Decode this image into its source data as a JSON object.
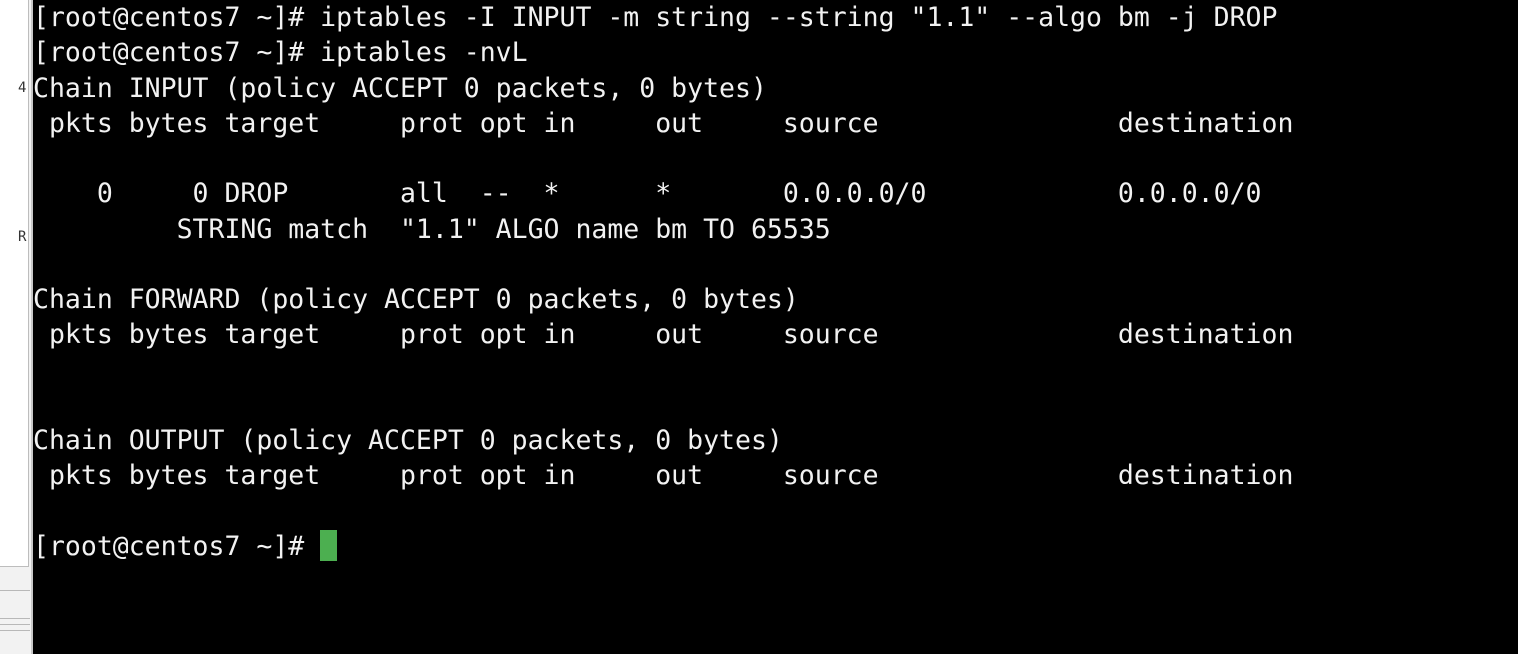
{
  "terminal": {
    "lines": [
      "[root@centos7 ~]# iptables -I INPUT -m string --string \"1.1\" --algo bm -j DROP",
      "[root@centos7 ~]# iptables -nvL",
      "Chain INPUT (policy ACCEPT 0 packets, 0 bytes)",
      " pkts bytes target     prot opt in     out     source               destination",
      "",
      "    0     0 DROP       all  --  *      *       0.0.0.0/0            0.0.0.0/0",
      "         STRING match  \"1.1\" ALGO name bm TO 65535",
      "",
      "Chain FORWARD (policy ACCEPT 0 packets, 0 bytes)",
      " pkts bytes target     prot opt in     out     source               destination",
      "",
      "",
      "Chain OUTPUT (policy ACCEPT 0 packets, 0 bytes)",
      " pkts bytes target     prot opt in     out     source               destination",
      ""
    ],
    "prompt": "[root@centos7 ~]# ",
    "cursor_color": "#4caf50"
  },
  "left_panel": {
    "glyph_top": "4",
    "glyph_bottom": "R"
  }
}
